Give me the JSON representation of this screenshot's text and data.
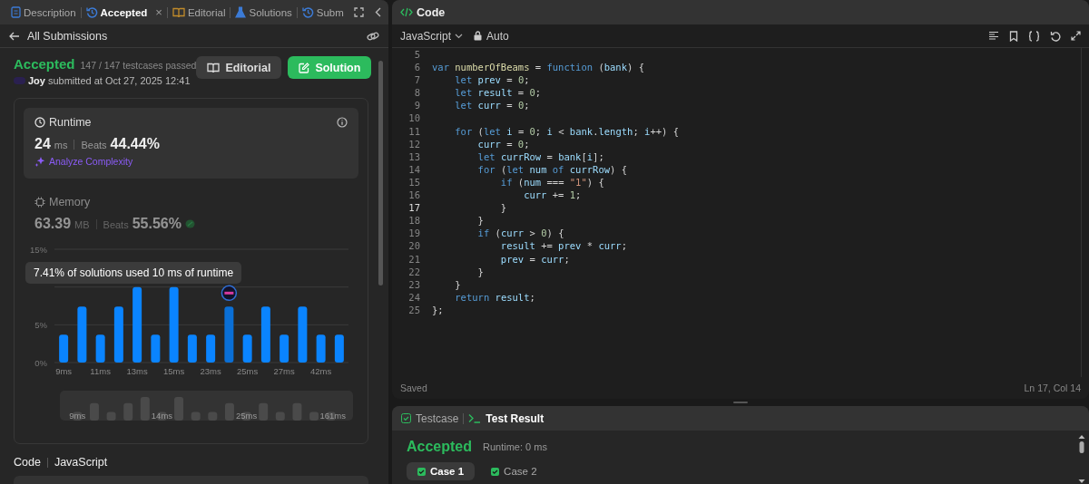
{
  "left_tabs": [
    {
      "label": "Description",
      "selected": false
    },
    {
      "label": "Accepted",
      "selected": true,
      "close": "×"
    },
    {
      "label": "Editorial",
      "selected": false
    },
    {
      "label": "Solutions",
      "selected": false
    },
    {
      "label": "Subm",
      "selected": false
    }
  ],
  "back_link": "All Submissions",
  "submission": {
    "status": "Accepted",
    "testcases": "147 / 147 testcases passed",
    "user": "Joy",
    "submitted": "submitted at Oct 27, 2025 12:41"
  },
  "actions": [
    {
      "label": "Editorial",
      "kind": "secondary"
    },
    {
      "label": "Solution",
      "kind": "primary"
    }
  ],
  "runtime": {
    "title": "Runtime",
    "value": "24",
    "unit": "ms",
    "beats_label": "Beats",
    "beats": "44.44%",
    "analyze": "Analyze Complexity",
    "selected": true
  },
  "memory": {
    "title": "Memory",
    "value": "63.39",
    "unit": "MB",
    "beats_label": "Beats",
    "beats": "55.56%",
    "selected": false
  },
  "chart_data": {
    "type": "bar",
    "categories": [
      "9ms",
      null,
      "11ms",
      null,
      "13ms",
      null,
      "15ms",
      null,
      "23ms",
      null,
      "25ms",
      null,
      "27ms",
      null,
      "42ms",
      null
    ],
    "values": [
      3.7,
      7.4,
      3.7,
      7.4,
      10,
      3.7,
      10,
      3.7,
      3.7,
      7.4,
      3.7,
      7.4,
      3.7,
      7.4,
      3.7,
      3.7
    ],
    "yticks": [
      {
        "value": 0,
        "label": "0%"
      },
      {
        "value": 5,
        "label": "5%"
      },
      {
        "value": 15,
        "label": "15%"
      }
    ],
    "ylim": [
      0,
      15
    ]
  },
  "tooltip": "7.41% of solutions used 10 ms of runtime",
  "navigator_labels": [
    {
      "label": "9ms"
    },
    {
      "label": "14ms"
    },
    {
      "label": "25ms"
    },
    {
      "label": "161ms"
    }
  ],
  "code_section": {
    "title": "Code",
    "language": "JavaScript"
  },
  "editor": {
    "title": "Code",
    "language": "JavaScript",
    "mode": "Auto",
    "status": "Saved",
    "cursor": "Ln 17, Col 14",
    "lines": [
      {
        "n": "5",
        "current": false
      },
      {
        "n": "6",
        "text": "var numberOfBeams = function (bank) {",
        "current": false
      },
      {
        "n": "7",
        "text": "    let prev = 0;",
        "current": false
      },
      {
        "n": "8",
        "text": "    let result = 0;",
        "current": false
      },
      {
        "n": "9",
        "text": "    let curr = 0;",
        "current": false
      },
      {
        "n": "10",
        "current": false
      },
      {
        "n": "11",
        "text": "    for (let i = 0; i < bank.length; i++) {",
        "current": false
      },
      {
        "n": "12",
        "text": "        curr = 0;",
        "current": false
      },
      {
        "n": "13",
        "text": "        let currRow = bank[i];",
        "current": false
      },
      {
        "n": "14",
        "text": "        for (let num of currRow) {",
        "current": false
      },
      {
        "n": "15",
        "text": "            if (num === \"1\") {",
        "current": false
      },
      {
        "n": "16",
        "text": "                curr += 1;",
        "current": false
      },
      {
        "n": "17",
        "text": "            }",
        "current": true
      },
      {
        "n": "18",
        "text": "        }",
        "current": false
      },
      {
        "n": "19",
        "text": "        if (curr > 0) {",
        "current": false
      },
      {
        "n": "20",
        "text": "            result += prev * curr;",
        "current": false
      },
      {
        "n": "21",
        "text": "            prev = curr;",
        "current": false
      },
      {
        "n": "22",
        "text": "        }",
        "current": false
      },
      {
        "n": "23",
        "text": "    }",
        "current": false
      },
      {
        "n": "24",
        "text": "    return result;",
        "current": false
      },
      {
        "n": "25",
        "text": "};",
        "current": false
      }
    ]
  },
  "test_tabs": [
    {
      "label": "Testcase",
      "selected": false
    },
    {
      "label": "Test Result",
      "selected": true
    }
  ],
  "result": {
    "status": "Accepted",
    "runtime": "Runtime: 0 ms"
  },
  "cases": [
    {
      "label": "Case 1",
      "selected": true,
      "passed": true
    },
    {
      "label": "Case 2",
      "selected": false,
      "passed": true
    }
  ]
}
